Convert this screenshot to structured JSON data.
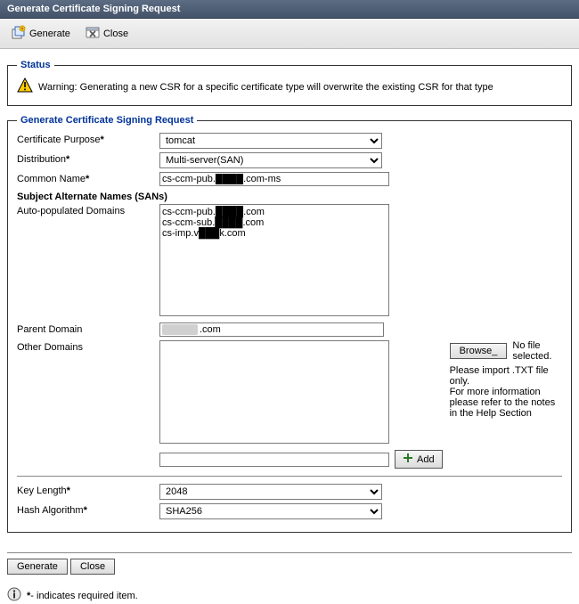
{
  "title": "Generate Certificate Signing Request",
  "toolbar": {
    "generate_label": "Generate",
    "close_label": "Close"
  },
  "status": {
    "legend": "Status",
    "warning_text": "Warning: Generating a new CSR for a specific certificate type will overwrite the existing CSR for that type"
  },
  "form": {
    "legend": "Generate Certificate Signing Request",
    "purpose": {
      "label": "Certificate Purpose",
      "value": "tomcat"
    },
    "distribution": {
      "label": "Distribution",
      "value": "Multi-server(SAN)"
    },
    "common_name": {
      "label": "Common Name",
      "value": "cs-ccm-pub.████.com-ms"
    },
    "san_heading": "Subject Alternate Names (SANs)",
    "auto_domains": {
      "label": "Auto-populated Domains",
      "value": "cs-ccm-pub.████.com\ncs-ccm-sub.████.com\ncs-imp.v███k.com"
    },
    "parent_domain": {
      "label": "Parent Domain",
      "suffix": ".com"
    },
    "other_domains": {
      "label": "Other Domains",
      "browse_label": "Browse_",
      "no_file_text": "No file selected.",
      "hint1": "Please import .TXT file only.",
      "hint2": "For more information please refer to the notes in the Help Section",
      "add_label": "Add"
    },
    "key_length": {
      "label": "Key Length",
      "value": "2048"
    },
    "hash_algorithm": {
      "label": "Hash Algorithm",
      "value": "SHA256"
    }
  },
  "footer": {
    "generate_label": "Generate",
    "close_label": "Close",
    "required_note": "- indicates required item."
  }
}
